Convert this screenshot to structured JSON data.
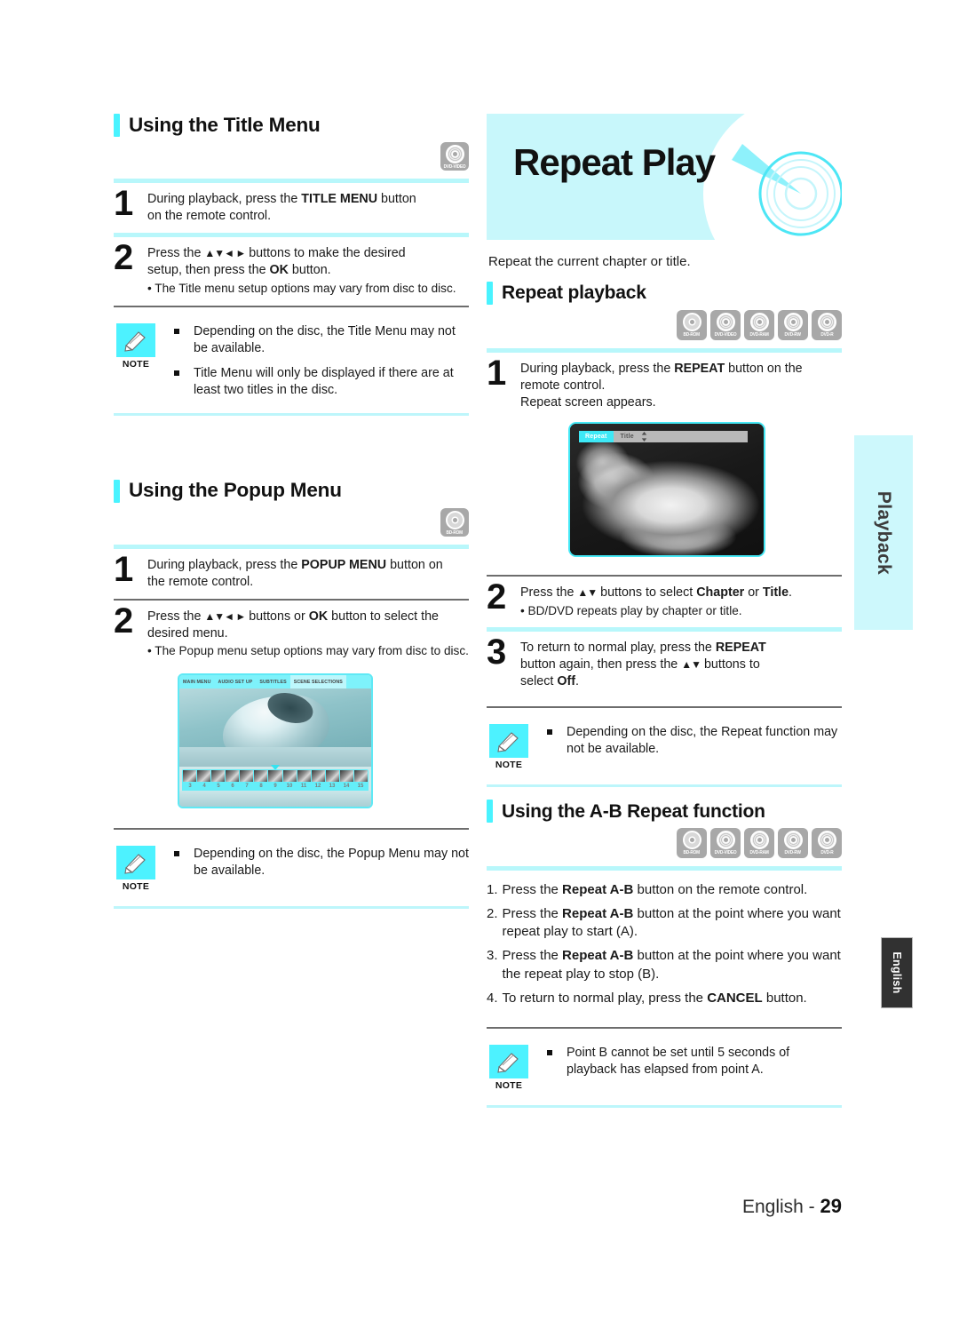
{
  "page": {
    "footer_label": "English -",
    "footer_number": "29",
    "side_tab_section": "Playback",
    "side_tab_language": "English"
  },
  "left_column": {
    "title_menu": {
      "heading": "Using the Title Menu",
      "badges": [
        {
          "name": "DVD-VIDEO",
          "glyph": "disc-waves-icon"
        }
      ],
      "steps": [
        {
          "num": "1",
          "line1_pre": "During playback, press the ",
          "line1_bold": "TITLE MENU",
          "line1_post": " button",
          "line2": "on the remote control."
        },
        {
          "num": "2",
          "line1_pre": "Press the ",
          "arrows": "▲▼◄ ►",
          "line1_mid": " buttons to make the desired",
          "line2_pre": "setup, then press the ",
          "line2_bold": "OK",
          "line2_post": " button.",
          "bullet": "• The Title menu setup options may vary from disc to disc."
        }
      ],
      "note": {
        "label": "NOTE",
        "items": [
          "Depending on the disc, the Title Menu may not be available.",
          "Title Menu will only be displayed if there are at least two titles in the disc."
        ]
      }
    },
    "popup_menu": {
      "heading": "Using the Popup Menu",
      "badges": [
        {
          "name": "BD-ROM",
          "glyph": "disc-plain-icon"
        }
      ],
      "steps": [
        {
          "num": "1",
          "line1_pre": "During playback, press the ",
          "line1_bold": "POPUP MENU",
          "line1_post": " button on",
          "line2": "the remote control."
        },
        {
          "num": "2",
          "line1_pre": "Press the ",
          "arrows": "▲▼◄ ►",
          "line1_mid": " buttons or ",
          "line1_bold": "OK",
          "line1_post": " button to select the",
          "line2": "desired menu.",
          "bullet": "• The Popup menu setup options may vary from disc to disc."
        }
      ],
      "screenshot": {
        "tabs": [
          "MAIN MENU",
          "AUDIO SET UP",
          "SUBTITLES",
          "SCENE SELECTIONS"
        ],
        "active_tab": "SCENE SELECTIONS",
        "chapter_numbers": [
          "3",
          "4",
          "5",
          "6",
          "7",
          "8",
          "9",
          "10",
          "11",
          "12",
          "13",
          "14",
          "15"
        ]
      },
      "note": {
        "label": "NOTE",
        "items": [
          "Depending on the disc, the Popup Menu may not be available."
        ]
      }
    }
  },
  "right_column": {
    "banner_title": "Repeat Play",
    "lead": "Repeat the current chapter or title.",
    "repeat_playback": {
      "heading": "Repeat playback",
      "badges": [
        {
          "name": "BD-ROM",
          "glyph": "disc-plain-icon"
        },
        {
          "name": "DVD-VIDEO",
          "glyph": "disc-waves-icon"
        },
        {
          "name": "DVD-RAM",
          "glyph": "disc-waves-icon"
        },
        {
          "name": "DVD-RW",
          "glyph": "disc-waves-icon"
        },
        {
          "name": "DVD-R",
          "glyph": "disc-waves-icon"
        }
      ],
      "steps": [
        {
          "num": "1",
          "line1_pre": "During playback, press the ",
          "line1_bold": "REPEAT",
          "line1_post": " button on the",
          "line2": "remote control.",
          "line3": "Repeat screen appears."
        },
        {
          "num": "2",
          "line1_pre": "Press the ",
          "arrows": "▲▼",
          "line1_mid": " buttons to select ",
          "line1_bold": "Chapter",
          "line1_mid2": " or ",
          "line1_bold2": "Title",
          "line1_post": ".",
          "bullet": "• BD/DVD repeats play by chapter or title."
        },
        {
          "num": "3",
          "line1_pre": "To return to normal play, press the ",
          "line1_bold": "REPEAT",
          "line2_pre": "button again, then press the ",
          "arrows": "▲▼",
          "line2_post": " buttons to",
          "line3_pre": "select ",
          "line3_bold": "Off",
          "line3_post": "."
        }
      ],
      "screenshot": {
        "osd_repeat_label": "Repeat",
        "osd_value_label": "Title",
        "osd_arrows": "↕"
      },
      "note": {
        "label": "NOTE",
        "items": [
          "Depending on the disc, the Repeat function may not be available."
        ]
      }
    },
    "ab_repeat": {
      "heading": "Using the A-B Repeat function",
      "badges": [
        {
          "name": "BD-ROM",
          "glyph": "disc-plain-icon"
        },
        {
          "name": "DVD-VIDEO",
          "glyph": "disc-waves-icon"
        },
        {
          "name": "DVD-RAM",
          "glyph": "disc-waves-icon"
        },
        {
          "name": "DVD-RW",
          "glyph": "disc-waves-icon"
        },
        {
          "name": "DVD-R",
          "glyph": "disc-waves-icon"
        }
      ],
      "items": [
        {
          "n": "1.",
          "pre": "Press the ",
          "bold": "Repeat A-B",
          "post": " button on the remote control."
        },
        {
          "n": "2.",
          "pre": "Press the ",
          "bold": "Repeat A-B",
          "post": " button at the point where you want repeat play to start (A)."
        },
        {
          "n": "3.",
          "pre": "Press the ",
          "bold": "Repeat A-B",
          "post": " button at the point where you want the repeat play to stop (B)."
        },
        {
          "n": "4.",
          "pre": "To return to normal play, press the ",
          "bold": "CANCEL",
          "post": " button."
        }
      ],
      "note": {
        "label": "NOTE",
        "items": [
          "Point B cannot be set until 5 seconds of playback has elapsed from point A."
        ]
      }
    }
  },
  "colors": {
    "accent_cyan": "#49f3ff",
    "banner_bg": "#c8f7fb",
    "rule_cyan": "#b8f7fb",
    "badge_gray": "#a8a8a8",
    "tab_dark": "#313131"
  }
}
